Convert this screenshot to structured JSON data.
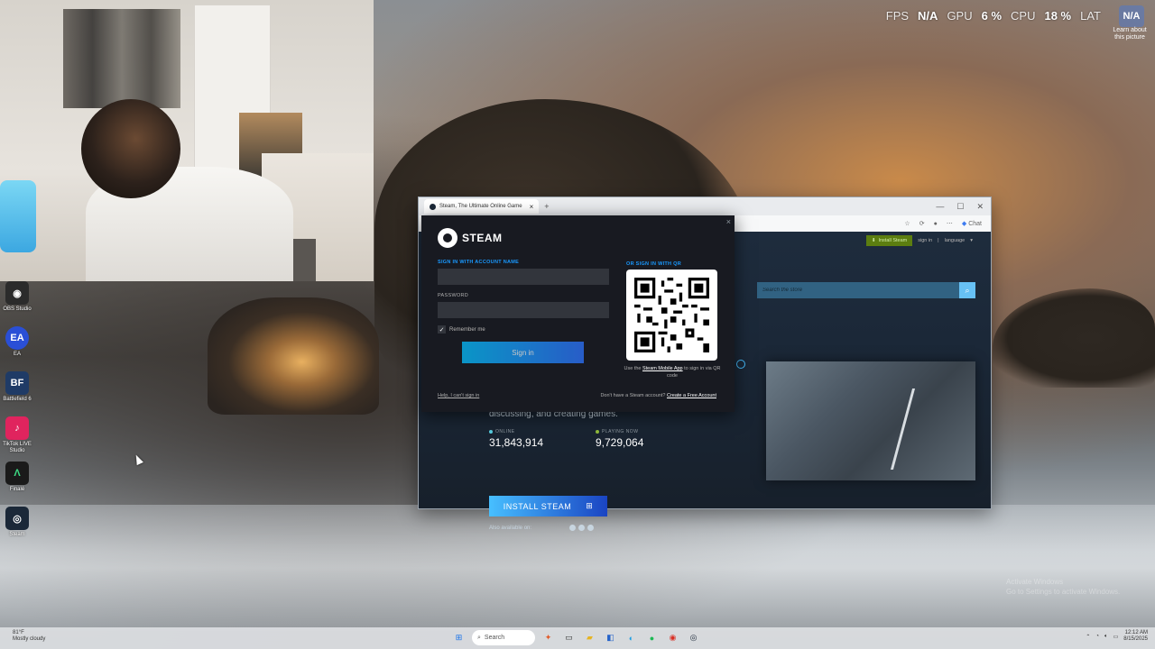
{
  "overlay": {
    "fps_label": "FPS",
    "fps_value": "N/A",
    "gpu_label": "GPU",
    "gpu_value": "6 %",
    "cpu_label": "CPU",
    "cpu_value": "18 %",
    "lat_label": "LAT",
    "lat_value": "N/A",
    "learn_text": "Learn about this picture"
  },
  "desktop_icons": [
    {
      "label": "OBS Studio",
      "icon": "obs-icon",
      "color": "#2b2b2b",
      "glyph": "◉"
    },
    {
      "label": "EA",
      "icon": "ea-icon",
      "color": "#2a4fd6",
      "glyph": "EA"
    },
    {
      "label": "Battlefield 6",
      "icon": "battlefield-icon",
      "color": "#1f3b66",
      "glyph": "BF"
    },
    {
      "label": "TikTok LIVE Studio",
      "icon": "tiktok-icon",
      "color": "#e0245e",
      "glyph": "♪"
    },
    {
      "label": "Finalé",
      "icon": "finale-icon",
      "color": "#1a1a1a",
      "glyph": "Λ"
    },
    {
      "label": "Steam",
      "icon": "steam-icon",
      "color": "#1b2838",
      "glyph": "◎"
    }
  ],
  "browser": {
    "tab_title": "Steam, The Ultimate Online Game",
    "chat_label": "Chat"
  },
  "steam_page": {
    "nav": {
      "install_label": "Install Steam",
      "signin_label": "sign in",
      "language_label": "language"
    },
    "search_placeholder": "Search the store",
    "hero_text": "discussing, and creating games.",
    "stats": {
      "online_label": "ONLINE",
      "online_value": "31,843,914",
      "playing_label": "PLAYING NOW",
      "playing_value": "9,729,064"
    },
    "install_button": "INSTALL STEAM",
    "also_available": "Also available on:"
  },
  "signin_modal": {
    "brand": "STEAM",
    "account_title": "SIGN IN WITH ACCOUNT NAME",
    "account_value": "",
    "password_label": "PASSWORD",
    "password_value": "",
    "remember_label": "Remember me",
    "remember_checked": true,
    "signin_button": "Sign in",
    "help_link": "Help, I can't sign in",
    "qr_title": "OR SIGN IN WITH QR",
    "qr_caption_pre": "Use the",
    "qr_caption_link": "Steam Mobile App",
    "qr_caption_post": "to sign in via QR code",
    "no_account_text": "Don't have a Steam account?",
    "create_link": "Create a Free Account"
  },
  "taskbar": {
    "weather_temp": "81°F",
    "weather_desc": "Mostly cloudy",
    "search_placeholder": "Search",
    "clock_time": "12:12 AM",
    "clock_date": "8/15/2025"
  },
  "watermark": {
    "line1": "Activate Windows",
    "line2": "Go to Settings to activate Windows."
  }
}
